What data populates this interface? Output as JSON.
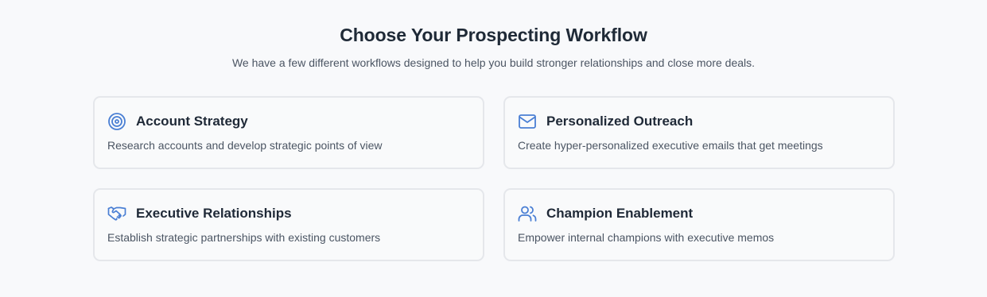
{
  "header": {
    "title": "Choose Your Prospecting Workflow",
    "subtitle": "We have a few different workflows designed to help you build stronger relationships and close more deals."
  },
  "accent_color": "#4a7fd4",
  "workflows": [
    {
      "icon": "target-icon",
      "title": "Account Strategy",
      "description": "Research accounts and develop strategic points of view"
    },
    {
      "icon": "mail-icon",
      "title": "Personalized Outreach",
      "description": "Create hyper-personalized executive emails that get meetings"
    },
    {
      "icon": "handshake-icon",
      "title": "Executive Relationships",
      "description": "Establish strategic partnerships with existing customers"
    },
    {
      "icon": "users-icon",
      "title": "Champion Enablement",
      "description": "Empower internal champions with executive memos"
    }
  ]
}
